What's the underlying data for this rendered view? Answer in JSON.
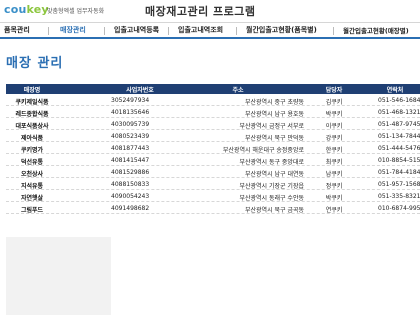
{
  "header": {
    "logo_main": "cou",
    "logo_highlight": "key",
    "tagline": "맞춤형엑셀 업무자동화",
    "app_title": "매장재고관리 프로그램"
  },
  "nav": {
    "items": [
      {
        "label": "품목관리"
      },
      {
        "label": "매장관리"
      },
      {
        "label": "입출고내역등록"
      },
      {
        "label": "입출고내역조회"
      },
      {
        "label": "월간입출고현황(품목별)"
      },
      {
        "label": "월간입출고현황(매장별)"
      }
    ],
    "active_index": 1,
    "active_color": "#2b6fb3"
  },
  "page": {
    "title": "매장 관리"
  },
  "table": {
    "header_color": "#1f3f73",
    "columns": [
      "매장명",
      "사업자번호",
      "주소",
      "담당자",
      "연락처"
    ],
    "rows": [
      {
        "name": "쿠키제일식품",
        "biz": "3052497934",
        "addr": "부산광역시 중구 초량동",
        "mgr": "김쿠키",
        "tel": "051-546-1684"
      },
      {
        "name": "레드종합식품",
        "biz": "4018135646",
        "addr": "부산광역시 남구 용호동",
        "mgr": "박쿠키",
        "tel": "051-468-1321"
      },
      {
        "name": "대포식품상사",
        "biz": "4030095739",
        "addr": "부산광역시 금정구 서부로",
        "mgr": "이쿠키",
        "tel": "051-487-9745"
      },
      {
        "name": "제아식품",
        "biz": "4080523439",
        "addr": "부산광역시 북구 만덕동",
        "mgr": "강쿠키",
        "tel": "051-134-7844"
      },
      {
        "name": "쿠키명가",
        "biz": "4081877443",
        "addr": "부산광역시 해운대구 송정중앙로",
        "mgr": "한쿠키",
        "tel": "051-444-5476"
      },
      {
        "name": "덕선유통",
        "biz": "4081415447",
        "addr": "부산광역시 동구 중앙대로",
        "mgr": "최쿠키",
        "tel": "010-8854-5154"
      },
      {
        "name": "오천상사",
        "biz": "4081529886",
        "addr": "부산광역시 남구 대연동",
        "mgr": "남쿠키",
        "tel": "051-784-4184"
      },
      {
        "name": "지석유통",
        "biz": "4088150833",
        "addr": "부산광역시 기장군 기장읍",
        "mgr": "정쿠키",
        "tel": "051-957-1568"
      },
      {
        "name": "자연햇살",
        "biz": "4090054243",
        "addr": "부산광역시 동래구 수안동",
        "mgr": "박쿠키",
        "tel": "051-335-8321"
      },
      {
        "name": "그림푸드",
        "biz": "4091498682",
        "addr": "부산광역시 북구 금곡동",
        "mgr": "연쿠키",
        "tel": "010-6874-9951"
      }
    ]
  }
}
